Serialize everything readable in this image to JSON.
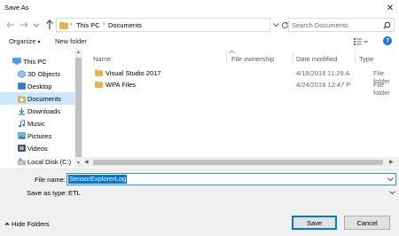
{
  "window": {
    "title": "Save As",
    "close_glyph": "✕"
  },
  "address": {
    "path": [
      "This PC",
      "Documents"
    ],
    "separator": "›"
  },
  "search": {
    "placeholder": "Search Documents"
  },
  "toolbar": {
    "organize_label": "Organize",
    "organize_caret": "▾",
    "new_folder_label": "New folder",
    "help_glyph": "?"
  },
  "sidebar": {
    "items": [
      {
        "label": "This PC",
        "icon": "computer-icon"
      },
      {
        "label": "3D Objects",
        "icon": "cube-folder-icon"
      },
      {
        "label": "Desktop",
        "icon": "desktop-folder-icon"
      },
      {
        "label": "Documents",
        "icon": "documents-folder-icon",
        "selected": true
      },
      {
        "label": "Downloads",
        "icon": "download-folder-icon"
      },
      {
        "label": "Music",
        "icon": "music-folder-icon"
      },
      {
        "label": "Pictures",
        "icon": "pictures-folder-icon"
      },
      {
        "label": "Videos",
        "icon": "videos-folder-icon"
      },
      {
        "label": "Local Disk (C:)",
        "icon": "drive-icon"
      }
    ]
  },
  "file_list": {
    "columns": [
      "Name",
      "File ownership",
      "Date modified",
      "Type"
    ],
    "rows": [
      {
        "name": "Visual Studio 2017",
        "date": "4/18/2018 11:29 A",
        "type": "File folder"
      },
      {
        "name": "WPA Files",
        "date": "4/24/2018 12:47 P",
        "type": "File folder"
      }
    ]
  },
  "form": {
    "file_name_label": "File name:",
    "file_name_value": "SensorExplorerLog",
    "save_type_label": "Save as type:",
    "save_type_value": "ETL"
  },
  "footer": {
    "hide_folders_label": "Hide Folders",
    "save_label": "Save",
    "cancel_label": "Cancel"
  },
  "colors": {
    "accent": "#0078d7",
    "selection": "#cce8ff",
    "folder_yellow": "#e8b545",
    "header_text": "#4c607a"
  }
}
